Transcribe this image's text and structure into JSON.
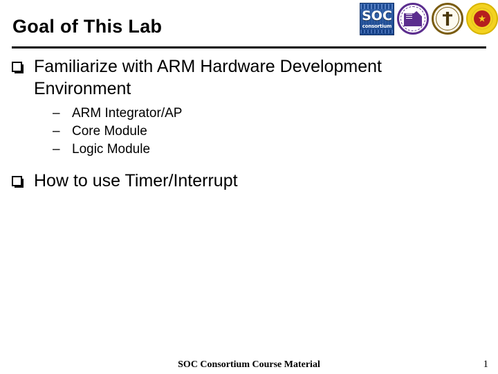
{
  "slide": {
    "title": "Goal of This Lab",
    "page_number": "1",
    "background_color": "#ffffff",
    "text_color": "#000000",
    "rule_color": "#000000"
  },
  "logos": [
    {
      "name": "soc-consortium-logo",
      "word": "SOC",
      "sub": "consortium",
      "color": "#1b4fa0",
      "shape": "square"
    },
    {
      "name": "nctu-seal-logo",
      "color": "#5b2d8e",
      "shape": "circle"
    },
    {
      "name": "ntu-seal-logo",
      "color": "#7a5c10",
      "shape": "circle"
    },
    {
      "name": "nthu-seal-logo",
      "color": "#f3d21f",
      "accent": "#b51f1f",
      "shape": "circle"
    }
  ],
  "content": {
    "bullet_marker": "❑",
    "sub_marker": "–",
    "items": [
      {
        "text": "Familiarize with ARM Hardware Development Environment",
        "subitems": [
          "ARM Integrator/AP",
          "Core Module",
          "Logic Module"
        ]
      },
      {
        "text": "How to use Timer/Interrupt",
        "subitems": []
      }
    ]
  },
  "footer": {
    "text": "SOC Consortium Course Material",
    "page": "1"
  }
}
